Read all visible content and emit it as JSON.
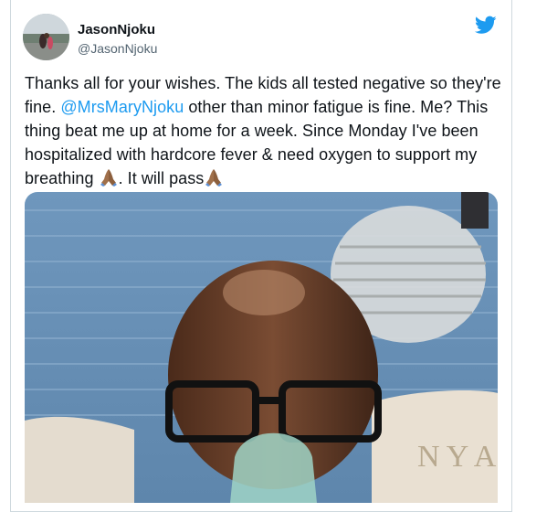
{
  "tweet": {
    "author_name": "JasonNjoku",
    "author_handle": "@JasonNjoku",
    "text_part1": "Thanks all for your wishes. The kids all tested negative so they're fine.",
    "mention": "@MrsMaryNjoku",
    "text_part2": "other than minor fatigue is fine. Me? This thing beat me up at home for a week. Since Monday I've been hospitalized with hardcore fever & need oxygen to support my breathing",
    "text_part3": ". It will pass",
    "emoji": "folded-hands-emoji",
    "media_caption": "N Y A N",
    "icons": {
      "brand": "twitter-bird-icon"
    },
    "colors": {
      "link": "#1d9bf0",
      "brand": "#1d9bf0",
      "text": "#0f1419",
      "secondary": "#536471"
    }
  }
}
